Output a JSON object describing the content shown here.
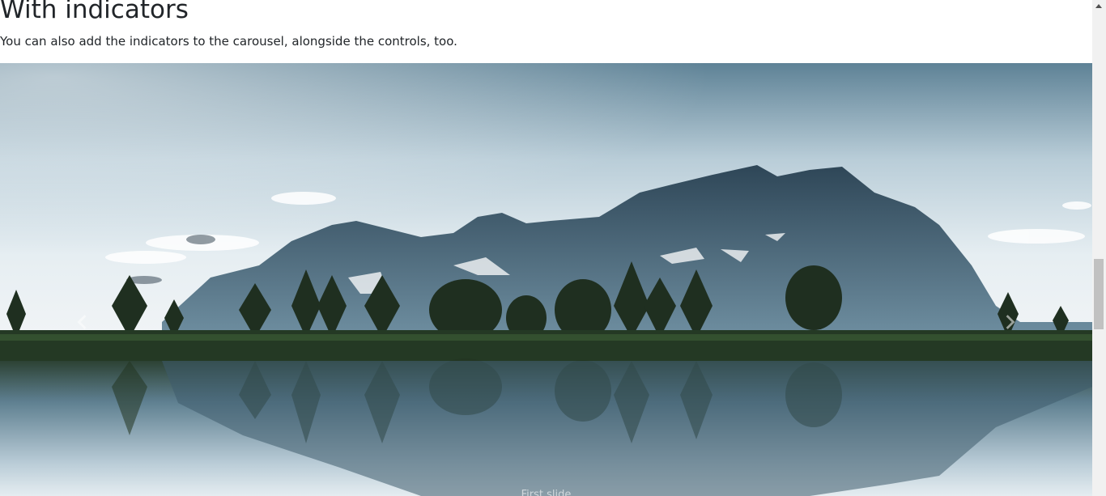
{
  "section": {
    "title": "With indicators",
    "description": "You can also add the indicators to the carousel, alongside the controls, too."
  },
  "carousel": {
    "caption": "First slide",
    "controls": {
      "prev_icon": "chevron-left-icon",
      "next_icon": "chevron-right-icon"
    }
  },
  "colors": {
    "text": "#212529",
    "sky": "#d6e3ea",
    "mountain": "#3b5668",
    "trees": "#20311f",
    "water": "#6d8da0"
  }
}
